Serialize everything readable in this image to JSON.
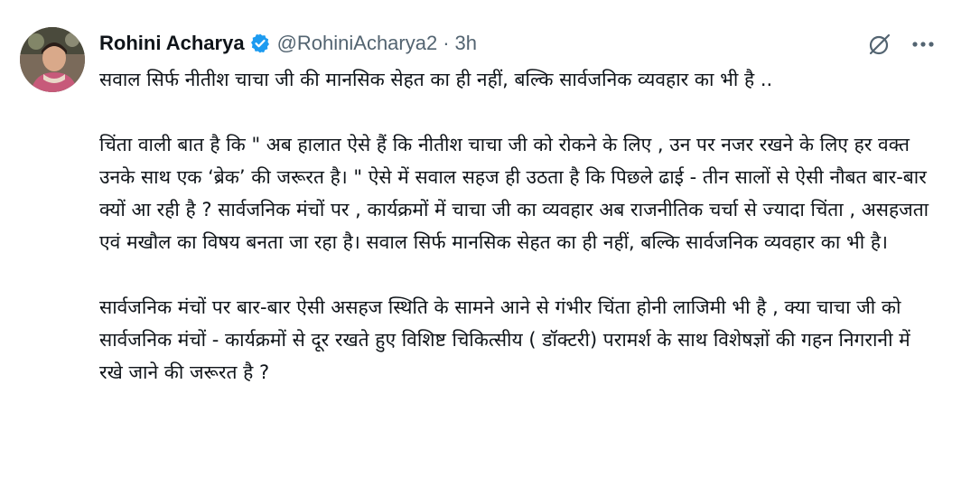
{
  "tweet": {
    "author": {
      "display_name": "Rohini Acharya",
      "handle": "@RohiniAcharya2",
      "verified": true,
      "avatar_icon": "profile-photo"
    },
    "separator": "·",
    "timestamp": "3h",
    "icons": {
      "grok": "grok-icon",
      "more": "more-icon"
    },
    "paragraphs": [
      "सवाल सिर्फ नीतीश चाचा जी की मानसिक सेहत का ही नहीं, बल्कि सार्वजनिक व्यवहार का भी है ..",
      "चिंता वाली बात है कि \" अब हालात ऐसे हैं कि नीतीश चाचा जी को रोकने के लिए , उन पर नजर रखने के लिए हर वक्त उनके साथ एक ‘ब्रेक’ की जरूरत है। \" ऐसे में सवाल सहज ही उठता है कि पिछले ढाई - तीन सालों से ऐसी नौबत बार-बार क्यों आ रही है ?  सार्वजनिक मंचों पर , कार्यक्रमों में चाचा जी का व्यवहार अब राजनीतिक चर्चा से ज्यादा चिंता , असहजता एवं मखौल का विषय बनता जा रहा है। सवाल सिर्फ मानसिक सेहत का ही नहीं, बल्कि सार्वजनिक व्यवहार का भी है।",
      "सार्वजनिक मंचों पर बार-बार ऐसी असहज स्थिति के सामने आने से गंभीर चिंता होनी लाजिमी भी है , क्या चाचा जी को सार्वजनिक मंचों - कार्यक्रमों से दूर रखते हुए विशिष्ट चिकित्सीय ( डॉक्टरी) परामर्श के साथ विशेषज्ञों की गहन निगरानी में रखे जाने की जरूरत है ?"
    ],
    "colors": {
      "text": "#0f1419",
      "secondary": "#536471",
      "verified_badge": "#1d9bf0"
    }
  }
}
